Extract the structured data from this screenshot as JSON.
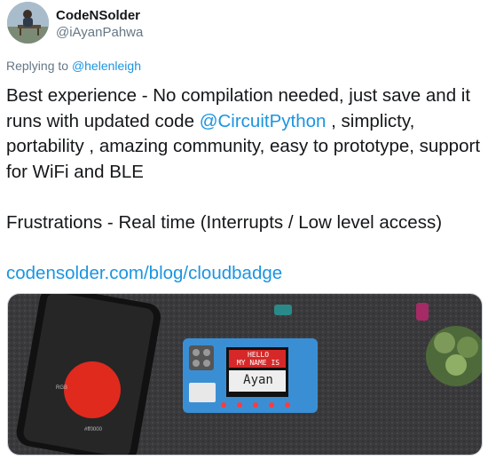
{
  "author": {
    "display_name": "CodeNSolder",
    "handle": "@iAyanPahwa",
    "avatar_icon": "avatar-person-on-bench"
  },
  "reply": {
    "prefix": "Replying to",
    "mention": "@helenleigh"
  },
  "tweet": {
    "line1_start": "Best experience - No compilation needed, just save and it runs with updated code ",
    "mention": "@CircuitPython",
    "line1_end": " , simplicty, portability , amazing community, easy to prototype, support for WiFi and BLE",
    "line2": "Frustrations -  Real time (Interrupts / Low level access)",
    "link": "codensolder.com/blog/cloudbadge"
  },
  "media": {
    "badge_header": "HELLO\nMY NAME IS",
    "badge_line1": "HELLO",
    "badge_line2": "MY NAME IS",
    "badge_name": "Ayan",
    "phone_label": "#ff0000",
    "phone_small": "RGB"
  },
  "colors": {
    "link": "#1b95e0",
    "secondary_text": "#657786",
    "primary_text": "#14171a"
  }
}
